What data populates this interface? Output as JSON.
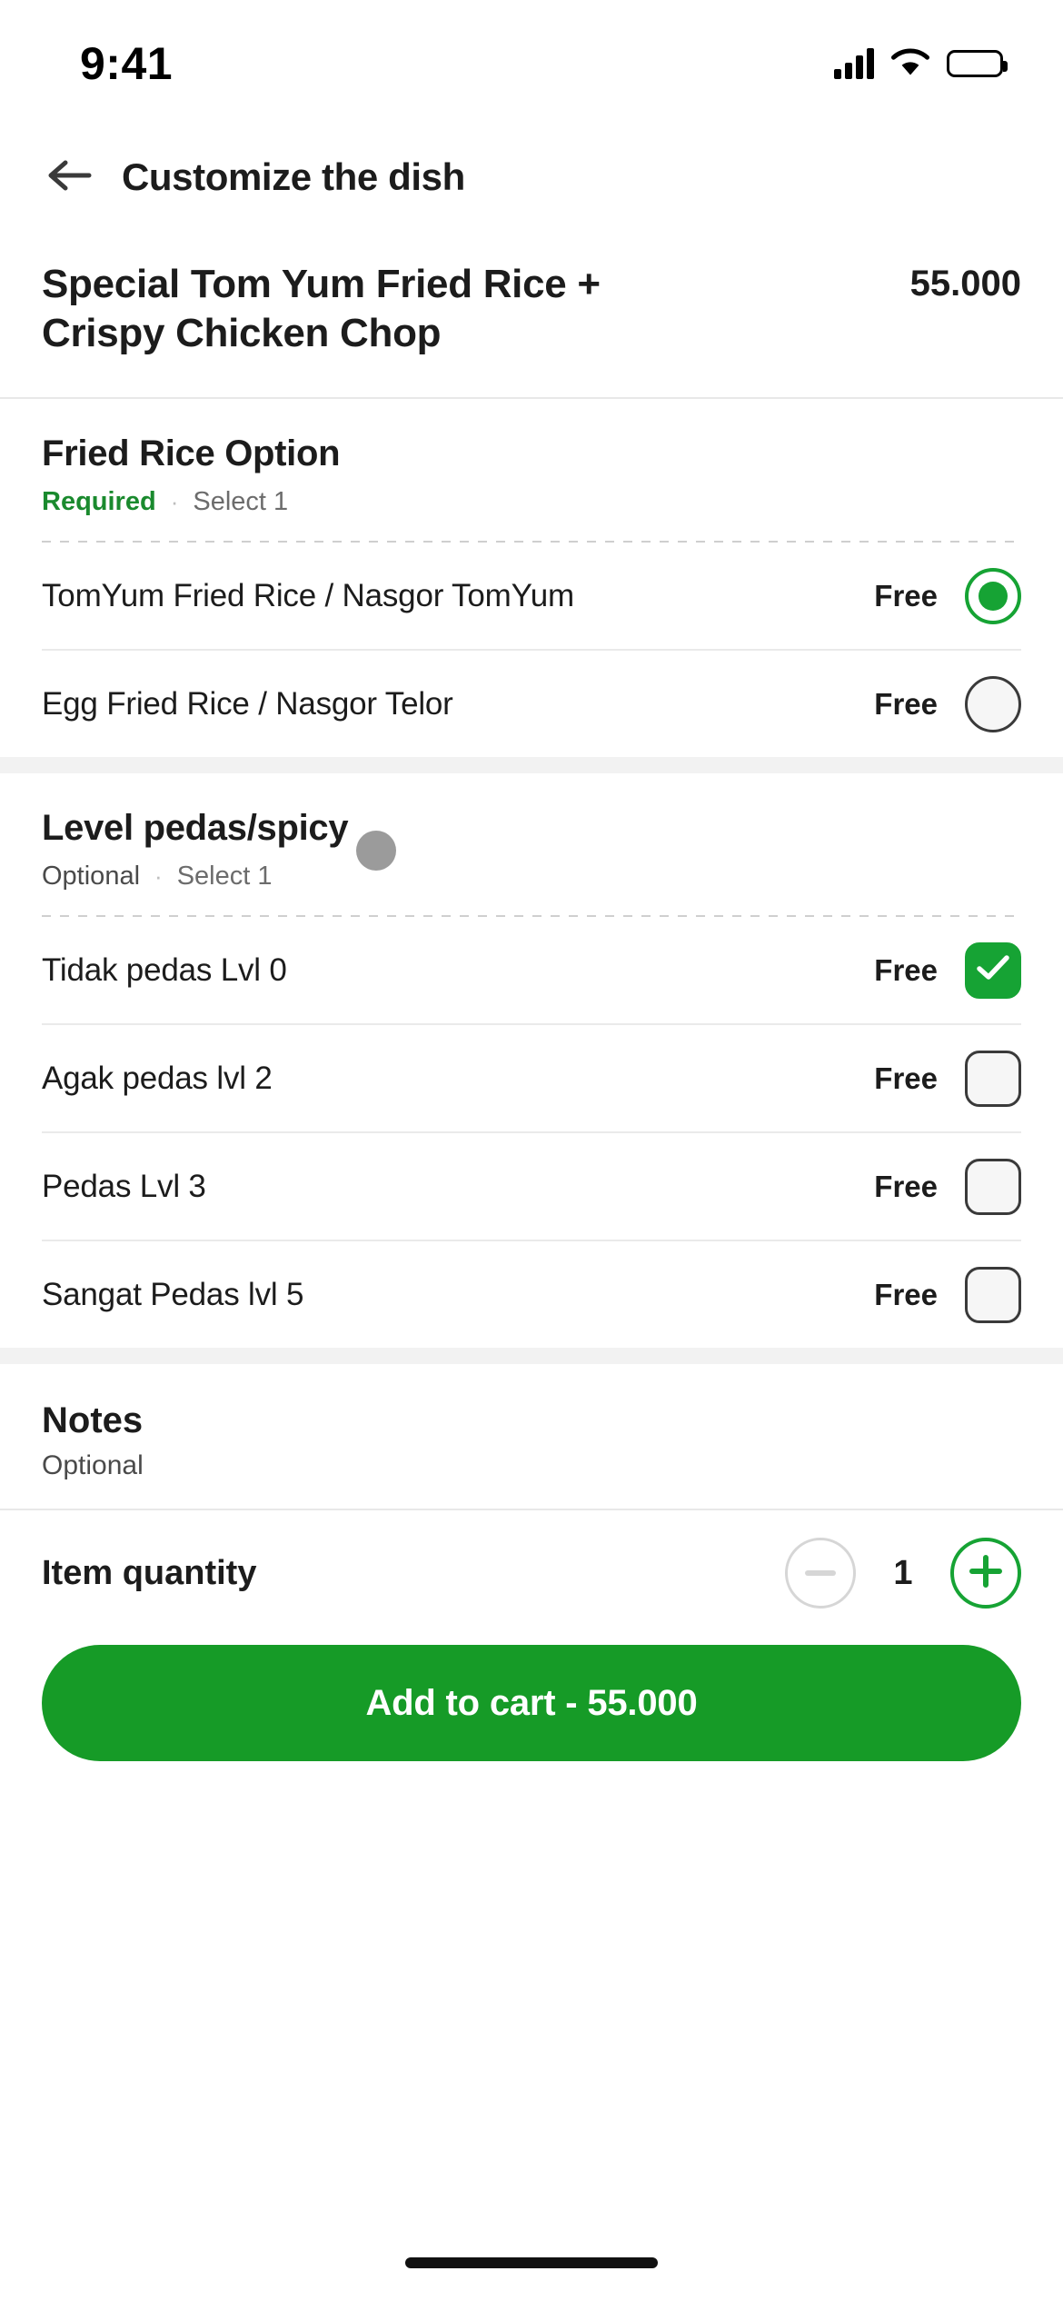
{
  "status_bar": {
    "time": "9:41",
    "signal_icon": "cellular-signal-icon",
    "wifi_icon": "wifi-icon",
    "battery_icon": "battery-icon"
  },
  "header": {
    "back_icon": "back-arrow-icon",
    "title": "Customize the dish"
  },
  "dish": {
    "name": "Special Tom Yum Fried Rice + Crispy Chicken Chop",
    "price": "55.000"
  },
  "colors": {
    "accent_green": "#16a334",
    "cta_green": "#169b27",
    "required_green": "#1a8a2e",
    "text_primary": "#1c1c1c",
    "text_muted": "#6c6c6c"
  },
  "groups": [
    {
      "title": "Fried Rice Option",
      "requirement": "Required",
      "requirement_type": "required",
      "separator": "·",
      "selection_rule": "Select 1",
      "control": "radio",
      "options": [
        {
          "label": "TomYum Fried Rice / Nasgor TomYum",
          "price": "Free",
          "selected": true
        },
        {
          "label": "Egg Fried Rice / Nasgor Telor",
          "price": "Free",
          "selected": false
        }
      ]
    },
    {
      "title": "Level pedas/spicy",
      "requirement": "Optional",
      "requirement_type": "optional",
      "separator": "·",
      "selection_rule": "Select 1",
      "control": "checkbox",
      "options": [
        {
          "label": "Tidak pedas Lvl 0",
          "price": "Free",
          "selected": true
        },
        {
          "label": "Agak pedas lvl 2",
          "price": "Free",
          "selected": false
        },
        {
          "label": "Pedas Lvl 3",
          "price": "Free",
          "selected": false
        },
        {
          "label": "Sangat Pedas lvl 5",
          "price": "Free",
          "selected": false
        }
      ]
    }
  ],
  "notes": {
    "title": "Notes",
    "subtitle": "Optional"
  },
  "quantity": {
    "label": "Item quantity",
    "value": "1",
    "decrement_icon": "minus-icon",
    "increment_icon": "plus-icon",
    "decrement_disabled": true
  },
  "cta": {
    "label": "Add to cart - 55.000"
  }
}
